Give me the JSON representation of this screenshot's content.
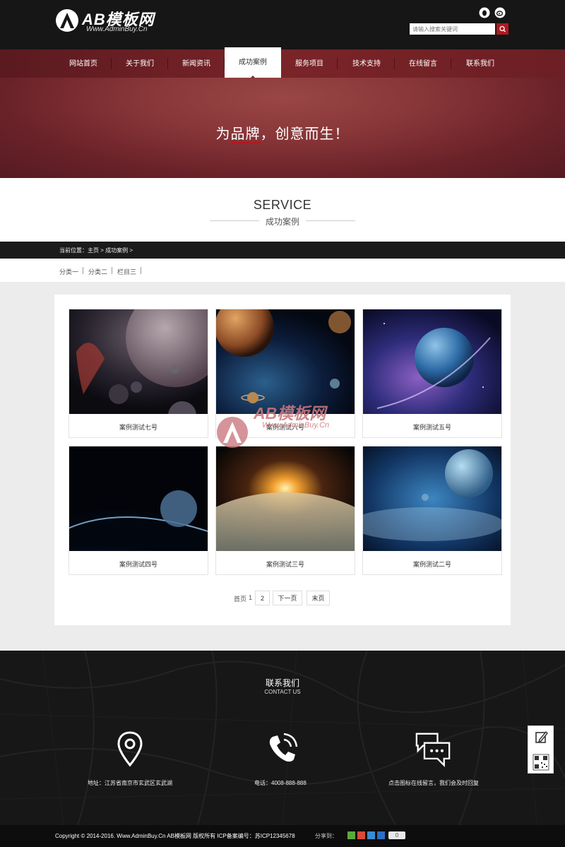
{
  "header": {
    "brand": "AB模板网",
    "url": "Www.AdminBuy.Cn",
    "search_placeholder": "请输入搜索关键词",
    "icons": [
      "qq-icon",
      "weibo-icon",
      "search-icon"
    ]
  },
  "nav": {
    "items": [
      {
        "label": "网站首页"
      },
      {
        "label": "关于我们"
      },
      {
        "label": "新闻资讯"
      },
      {
        "label": "成功案例",
        "active": true
      },
      {
        "label": "服务项目"
      },
      {
        "label": "技术支持"
      },
      {
        "label": "在线留言"
      },
      {
        "label": "联系我们"
      }
    ]
  },
  "banner": {
    "text_before": "为",
    "text_underlined": "品牌",
    "text_after": "，创意而生！"
  },
  "section": {
    "title_en": "SERVICE",
    "title_zh": "成功案例"
  },
  "breadcrumb": "当前位置：主页 > 成功案例 >",
  "categories": [
    "分类一",
    "分类二",
    "栏目三"
  ],
  "cases": [
    {
      "caption": "案例测试七号"
    },
    {
      "caption": "案例测试六号"
    },
    {
      "caption": "案例测试五号"
    },
    {
      "caption": "案例测试四号"
    },
    {
      "caption": "案例测试三号"
    },
    {
      "caption": "案例测试二号"
    }
  ],
  "watermark": {
    "text": "AB模板网",
    "url": "Www.AdminBuy.Cn"
  },
  "pager": {
    "first_label": "首页",
    "current": "1",
    "page2": "2",
    "next_label": "下一页",
    "last_label": "末页"
  },
  "footer": {
    "title": "联系我们",
    "subtitle": "CONTACT US",
    "address": "地址：江苏省南京市玄武区玄武湖",
    "phone": "电话：4008-888-888",
    "message": "点击图标在线留言，我们会及时回复",
    "copyright": "Copyright © 2014-2016. Www.AdminBuy.Cn AB模板网 版权所有  ICP备案编号：苏ICP12345678",
    "share_label": "分享到：",
    "share_count": "0"
  },
  "colors": {
    "accent": "#b3171f",
    "nav_bg": "#6c1f24",
    "header_bg": "#161616",
    "footer_bg": "#171717"
  }
}
